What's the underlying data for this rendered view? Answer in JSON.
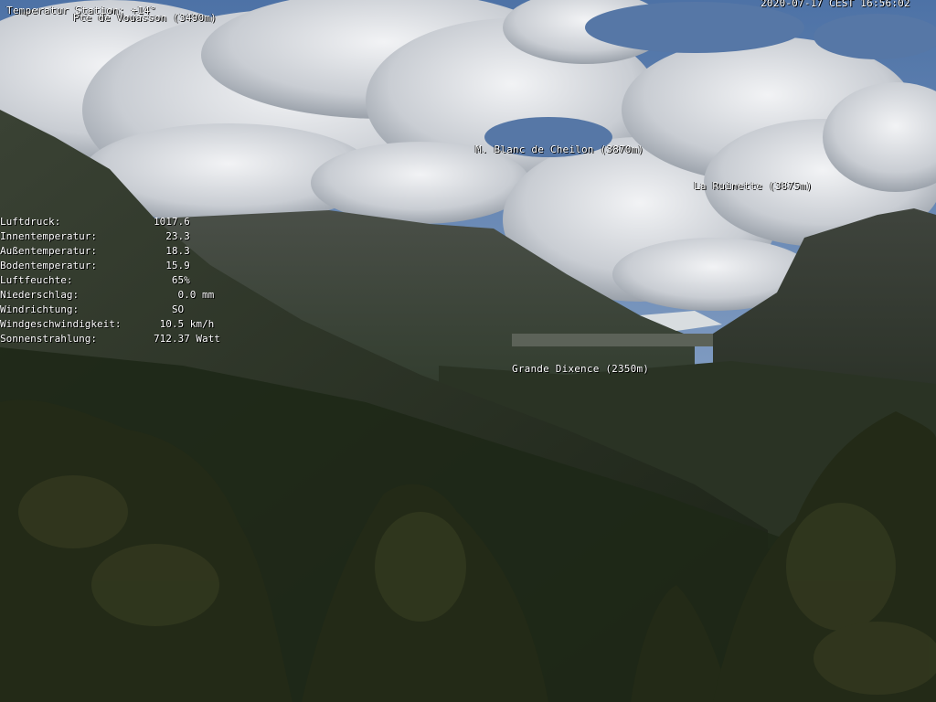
{
  "overlay": {
    "station_title": "Temperatur Station: +14°",
    "station_subtitle": "Pte de Vouasson (3490m)",
    "timestamp": "2020-07-17 CEST 16:56:02"
  },
  "peaks": [
    {
      "label": "M. Blanc de Cheilon (3870m)"
    },
    {
      "label": "La Ruinette (3875m)"
    },
    {
      "label": "Grande Dixence (2350m)"
    }
  ],
  "weather": [
    {
      "label": "Luftdruck:",
      "value": "1017.6"
    },
    {
      "label": "Innentemperatur:",
      "value": "  23.3"
    },
    {
      "label": "Außentemperatur:",
      "value": "  18.3"
    },
    {
      "label": "Bodentemperatur:",
      "value": "  15.9"
    },
    {
      "label": "Luftfeuchte:",
      "value": "   65%"
    },
    {
      "label": "Niederschlag:",
      "value": "    0.0 mm"
    },
    {
      "label": "Windrichtung:",
      "value": "   SO"
    },
    {
      "label": "Windgeschwindigkeit:",
      "value": " 10.5 km/h"
    },
    {
      "label": "Sonnenstrahlung:",
      "value": "712.37 Watt"
    }
  ],
  "colors": {
    "sky": "#5b7fae",
    "cloud": "#e4e7eb",
    "mountain_dark": "#2a3125",
    "forest": "#1e2a17",
    "text": "#ffffff"
  }
}
